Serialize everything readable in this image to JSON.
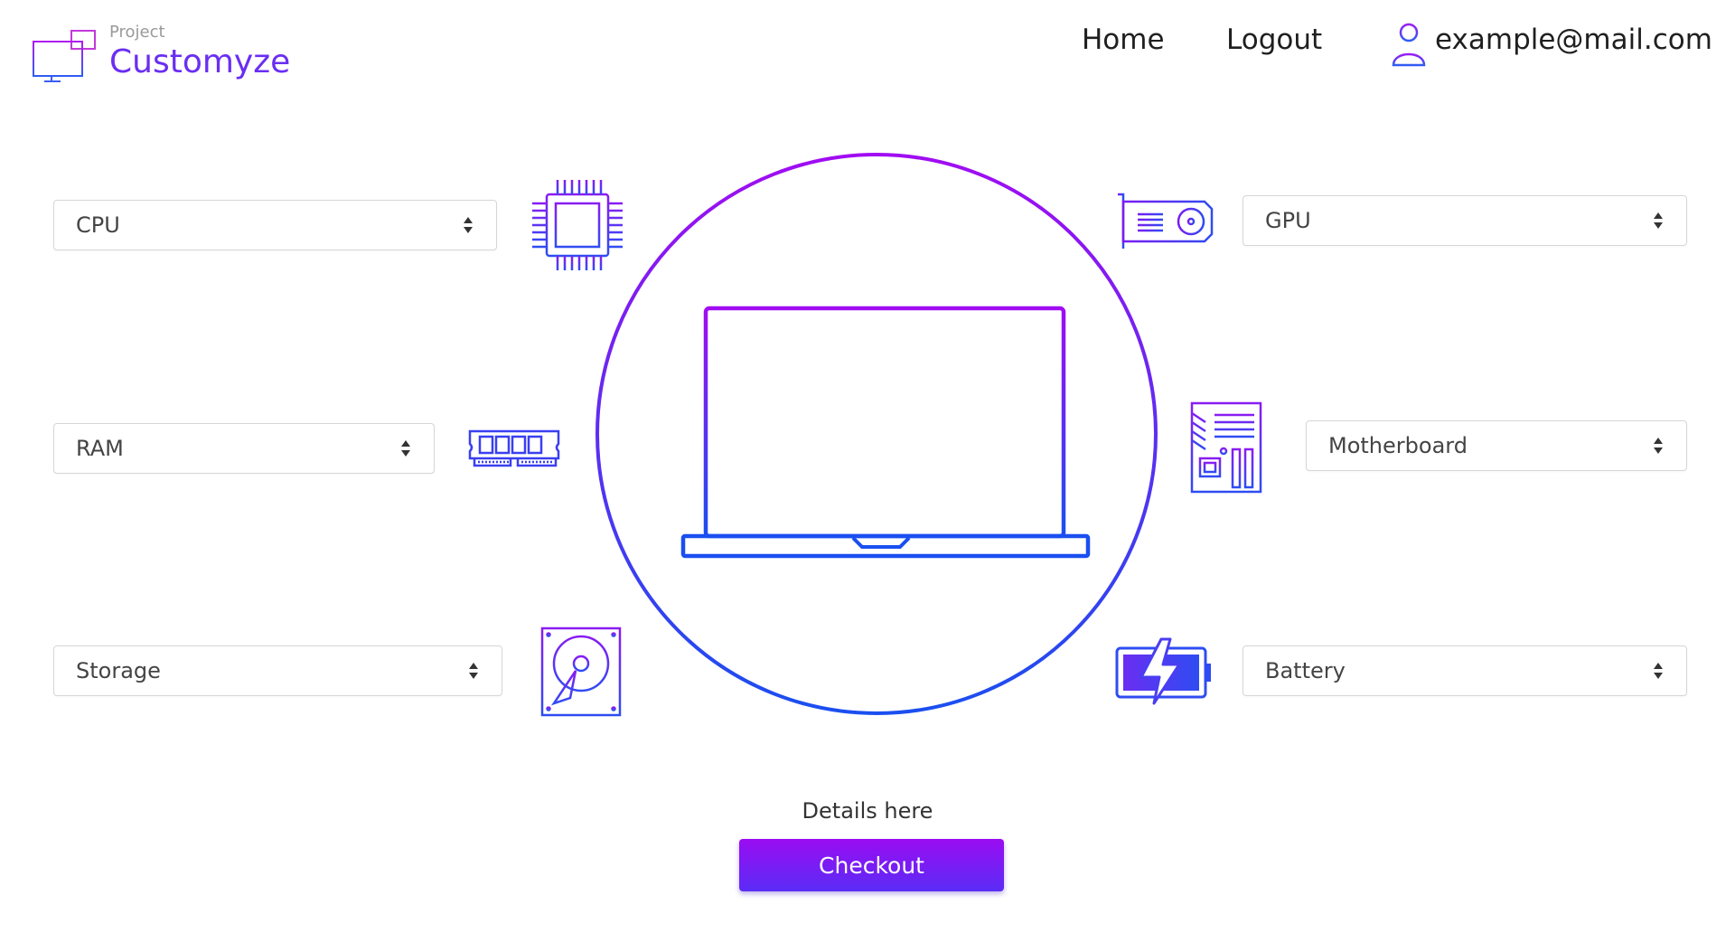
{
  "brand": {
    "project_label": "Project",
    "name": "Customyze"
  },
  "nav": {
    "home": "Home",
    "logout": "Logout",
    "email": "example@mail.com"
  },
  "selects": {
    "cpu": "CPU",
    "ram": "RAM",
    "storage": "Storage",
    "gpu": "GPU",
    "motherboard": "Motherboard",
    "battery": "Battery"
  },
  "footer": {
    "details": "Details here",
    "checkout": "Checkout"
  },
  "colors": {
    "accent_purple": "#9a0cf2",
    "accent_blue": "#1a4ff0",
    "brand_text": "#6a2ef2"
  }
}
